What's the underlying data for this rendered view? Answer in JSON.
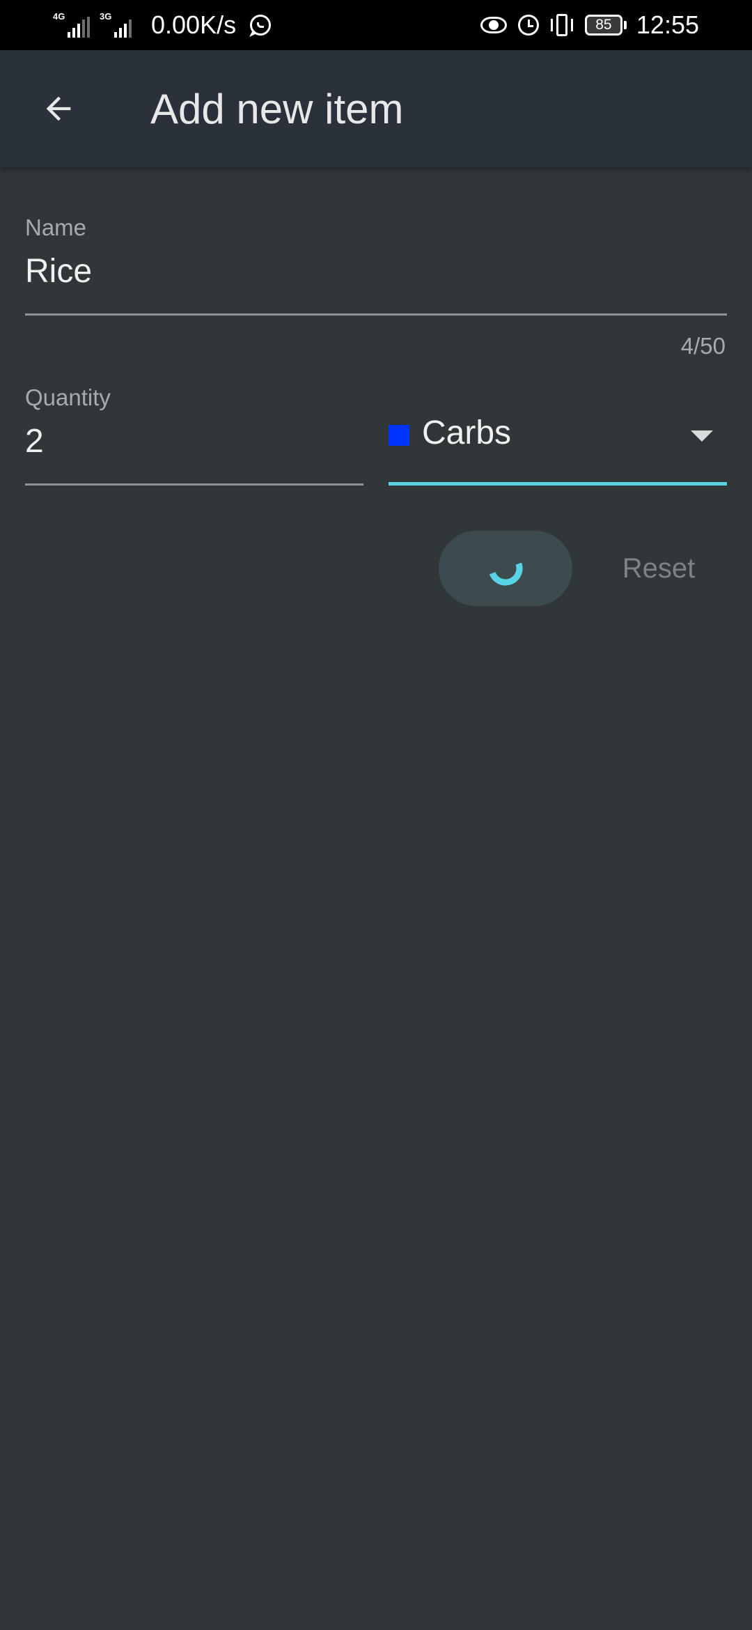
{
  "status_bar": {
    "network_1_tag": "4G",
    "network_2_tag": "3G",
    "net_speed": "0.00K/s",
    "battery_level": "85",
    "time": "12:55",
    "icons": [
      "signal-icon",
      "whatsapp-icon",
      "eye-icon",
      "alarm-icon",
      "vibrate-icon",
      "battery-icon"
    ]
  },
  "app_bar": {
    "title": "Add new item",
    "back_icon": "arrow-left-icon"
  },
  "form": {
    "name": {
      "label": "Name",
      "value": "Rice",
      "counter": "4/50"
    },
    "quantity": {
      "label": "Quantity",
      "value": "2"
    },
    "category": {
      "selected": "Carbs",
      "swatch_color": "#0033ff",
      "dropdown_icon": "caret-down-icon"
    }
  },
  "actions": {
    "save_state": "loading",
    "reset_label": "Reset"
  },
  "colors": {
    "background": "#313739",
    "app_bar": "#2b313a",
    "accent": "#58d3e6",
    "status_bar": "#000000"
  }
}
